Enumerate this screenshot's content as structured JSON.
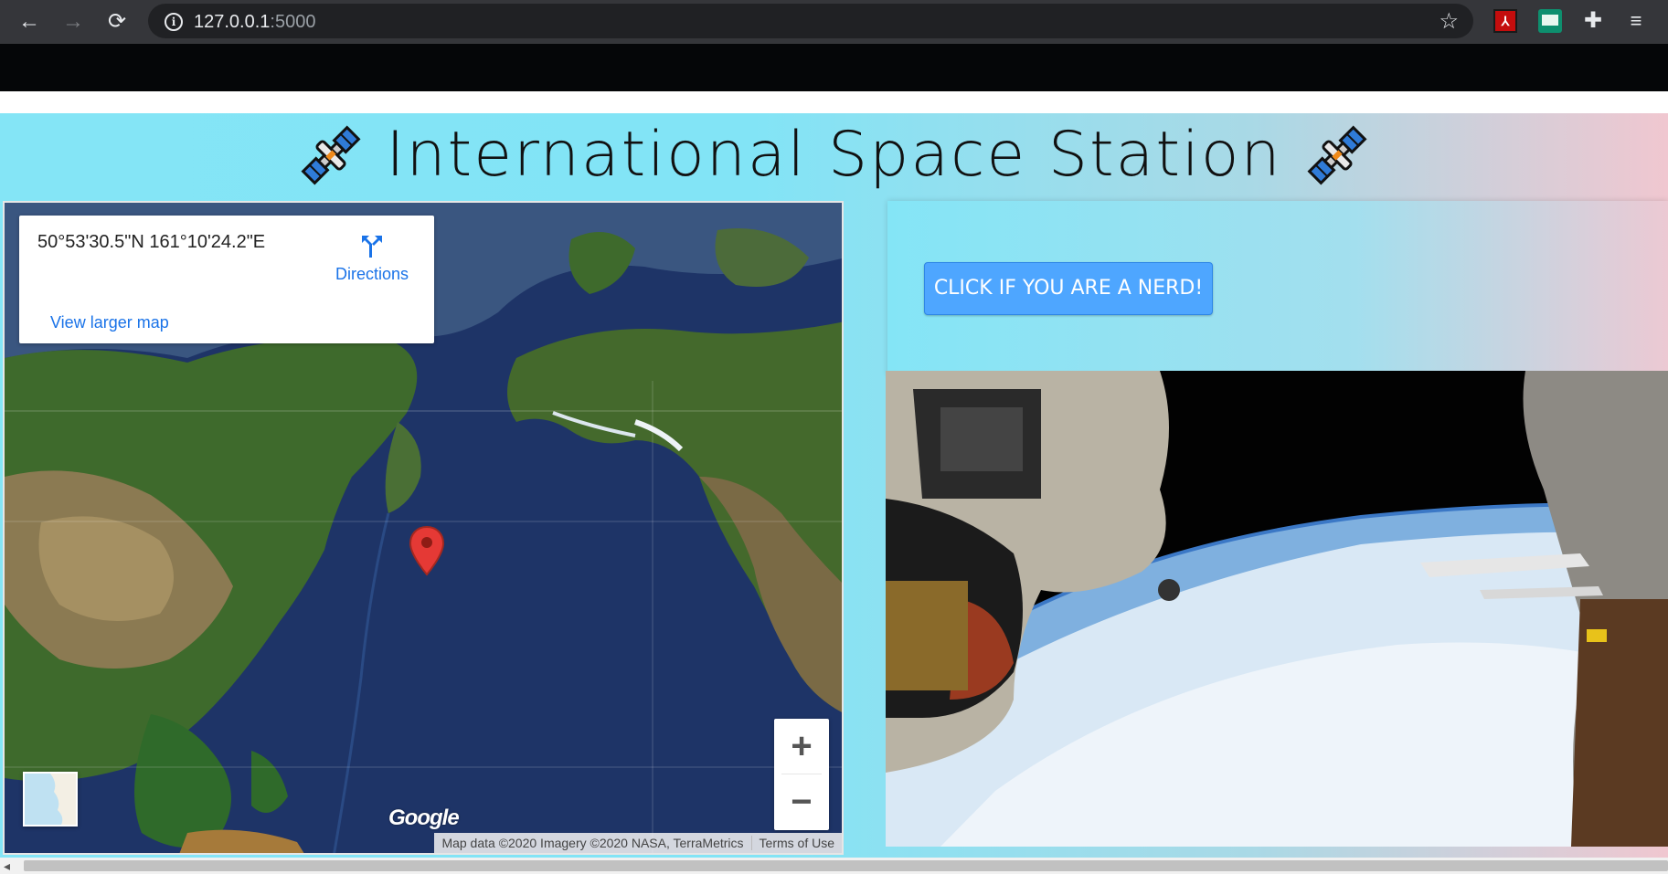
{
  "browser": {
    "url_host": "127.0.0.1",
    "url_port": ":5000",
    "icons": [
      "back-icon",
      "forward-icon",
      "reload-icon",
      "info-icon",
      "star-icon",
      "pdf-extension-icon",
      "green-extension-icon",
      "puzzle-icon",
      "queue-icon"
    ]
  },
  "header": {
    "title": "International Space Station"
  },
  "map": {
    "coordinates": "50°53'30.5\"N 161°10'24.2\"E",
    "directions_label": "Directions",
    "view_larger_label": "View larger map",
    "zoom_in": "+",
    "zoom_out": "−",
    "logo": "Google",
    "map_data": "Map data ©2020 Imagery ©2020 NASA, TerraMetrics",
    "terms": "Terms of Use"
  },
  "panel": {
    "nerd_button_label": "CLICK IF YOU ARE A NERD!"
  },
  "colors": {
    "accent": "#4ea6ff",
    "page_gradient_start": "#84e5f6",
    "page_gradient_end": "#f0c7d0",
    "map_pin": "#e53935"
  }
}
